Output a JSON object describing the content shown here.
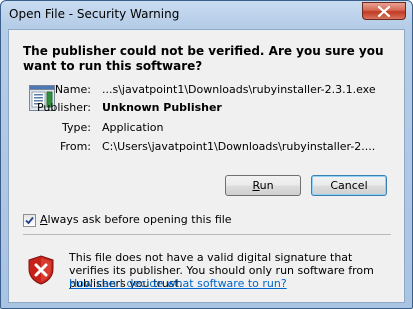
{
  "window": {
    "title": "Open File - Security Warning"
  },
  "dialog": {
    "headline": "The publisher could not be verified.  Are you sure you want to run this software?",
    "fields": [
      {
        "label": "Name:",
        "value": "...s\\javatpoint1\\Downloads\\rubyinstaller-2.3.1.exe"
      },
      {
        "label": "Publisher:",
        "value": "Unknown Publisher"
      },
      {
        "label": "Type:",
        "value": "Application"
      },
      {
        "label": "From:",
        "value": "C:\\Users\\javatpoint1\\Downloads\\rubyinstaller-2...."
      }
    ],
    "run_button": "Run",
    "cancel_button": "Cancel",
    "checkbox_label": "Always ask before opening this file",
    "checkbox_checked": true,
    "warning_text": "This file does not have a valid digital signature that verifies its publisher.  You should only run software from publishers you trust.",
    "help_link": "How can I decide what software to run?"
  },
  "colors": {
    "link": "#0066cc",
    "shield_red": "#c8211a",
    "titlebar": "#b6cde8"
  },
  "icons": [
    "close-icon",
    "file-icon",
    "checkmark-icon",
    "security-shield-icon"
  ]
}
